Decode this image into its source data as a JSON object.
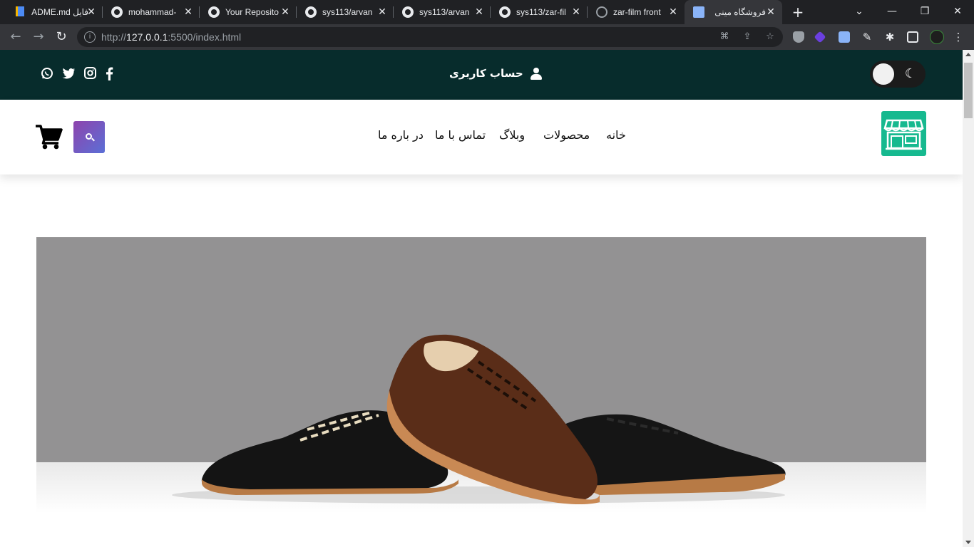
{
  "browser": {
    "tabs": [
      {
        "title": "فایل README.md",
        "icon": "book-icon"
      },
      {
        "title": "mohammad-",
        "icon": "github-icon"
      },
      {
        "title": "Your Reposito",
        "icon": "github-icon"
      },
      {
        "title": "sys113/arvan",
        "icon": "github-icon"
      },
      {
        "title": "sys113/arvan",
        "icon": "github-icon"
      },
      {
        "title": "sys113/zar-fil",
        "icon": "github-icon"
      },
      {
        "title": "zar-film front",
        "icon": "globe-icon"
      },
      {
        "title": "فروشگاه مینی",
        "icon": "shop-icon",
        "active": true
      }
    ],
    "url_scheme_host_prefix": "http://",
    "url_host": "127.0.0.1",
    "url_rest": ":5500/index.html"
  },
  "topbar": {
    "account_label": "حساب کاربری",
    "social": [
      "whatsapp-icon",
      "twitter-icon",
      "instagram-icon",
      "facebook-icon"
    ],
    "background": "#072c2c"
  },
  "nav": {
    "items": [
      "خانه",
      "محصولات",
      "وبلاگ",
      "تماس با ما",
      "در باره ما"
    ]
  },
  "colors": {
    "logo": "#16b98f",
    "search_gradient_start": "#8e44ad",
    "search_gradient_end": "#5b6fd6",
    "hero_wall": "#939293"
  }
}
